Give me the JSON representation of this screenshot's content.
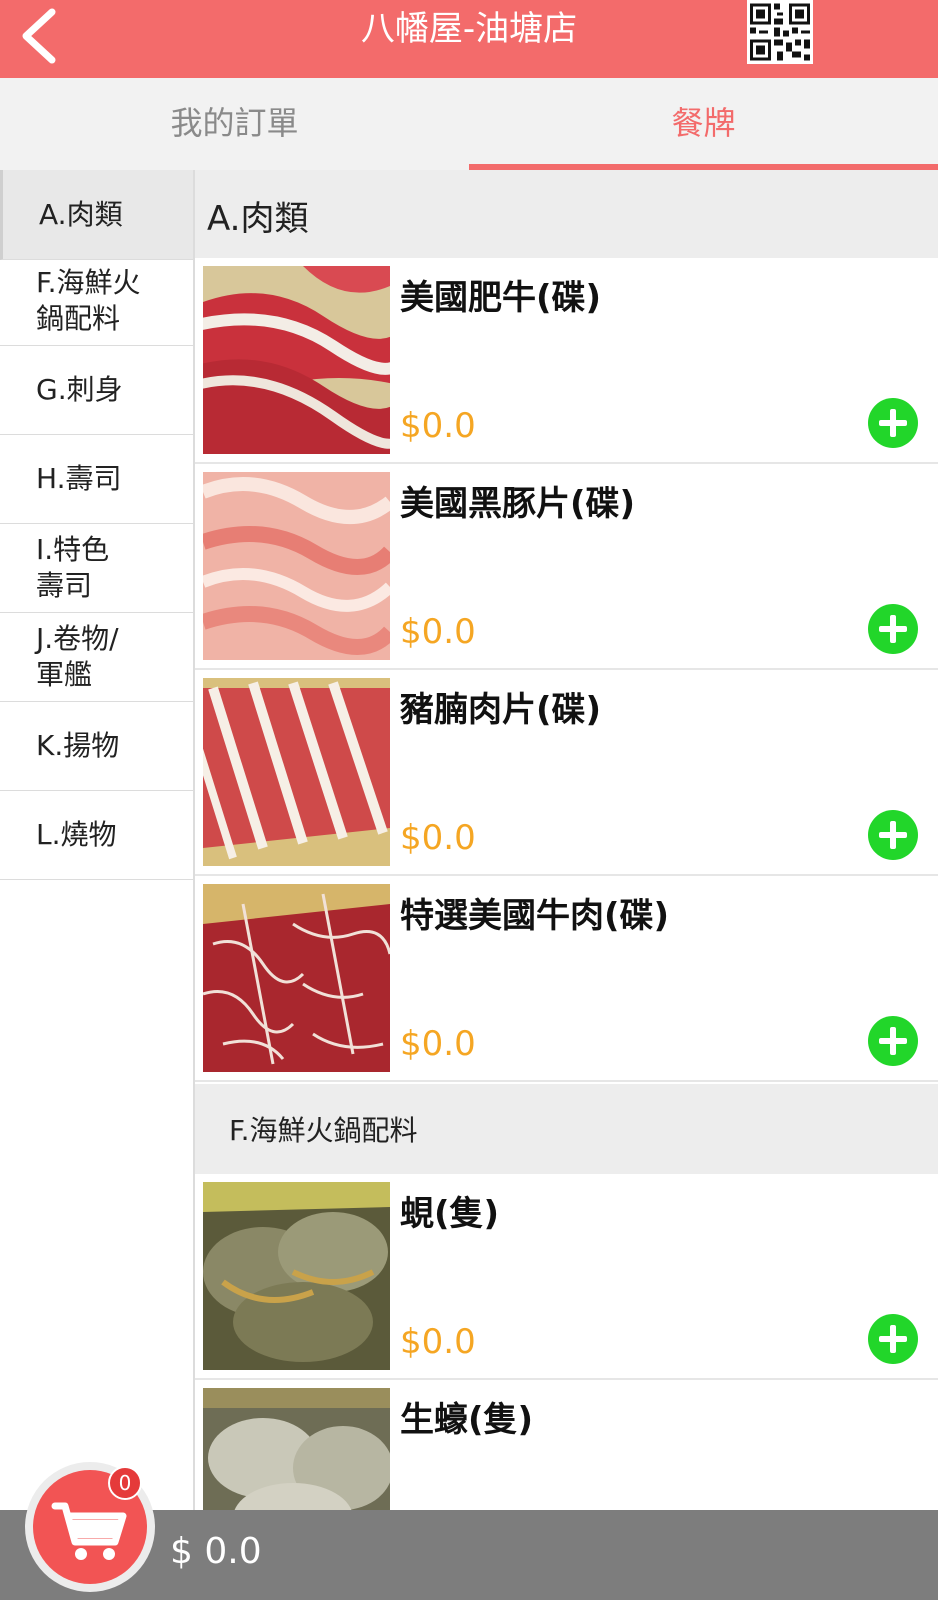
{
  "header": {
    "title": "八幡屋-油塘店",
    "back_icon": "chevron-left-icon",
    "qr_icon": "qr-code-icon"
  },
  "tabs": [
    {
      "label": "我的訂單",
      "active": false
    },
    {
      "label": "餐牌",
      "active": true
    }
  ],
  "sidebar": {
    "categories": [
      {
        "label": "A.肉類",
        "active": true
      },
      {
        "label": "F.海鮮火鍋配料"
      },
      {
        "label": "G.刺身"
      },
      {
        "label": "H.壽司"
      },
      {
        "label": "I.特色壽司"
      },
      {
        "label": "J.卷物/軍艦"
      },
      {
        "label": "K.揚物"
      },
      {
        "label": "L.燒物"
      }
    ]
  },
  "menu": {
    "sections": [
      {
        "title": "A.肉類",
        "items": [
          {
            "name": "美國肥牛(碟)",
            "price": "$0.0"
          },
          {
            "name": "美國黑豚片(碟)",
            "price": "$0.0"
          },
          {
            "name": "豬腩肉片(碟)",
            "price": "$0.0"
          },
          {
            "name": "特選美國牛肉(碟)",
            "price": "$0.0"
          }
        ]
      },
      {
        "title": "F.海鮮火鍋配料",
        "items": [
          {
            "name": "蜆(隻)",
            "price": "$0.0"
          },
          {
            "name": "生蠔(隻)",
            "price": ""
          }
        ]
      }
    ]
  },
  "cart": {
    "count": "0",
    "total": "$ 0.0",
    "icon": "shopping-cart-icon"
  },
  "colors": {
    "header": "#f36b6b",
    "price": "#f5a623",
    "add_button": "#22d62a",
    "cart": "#f25454",
    "bottom_bar": "#7d7d7d"
  }
}
